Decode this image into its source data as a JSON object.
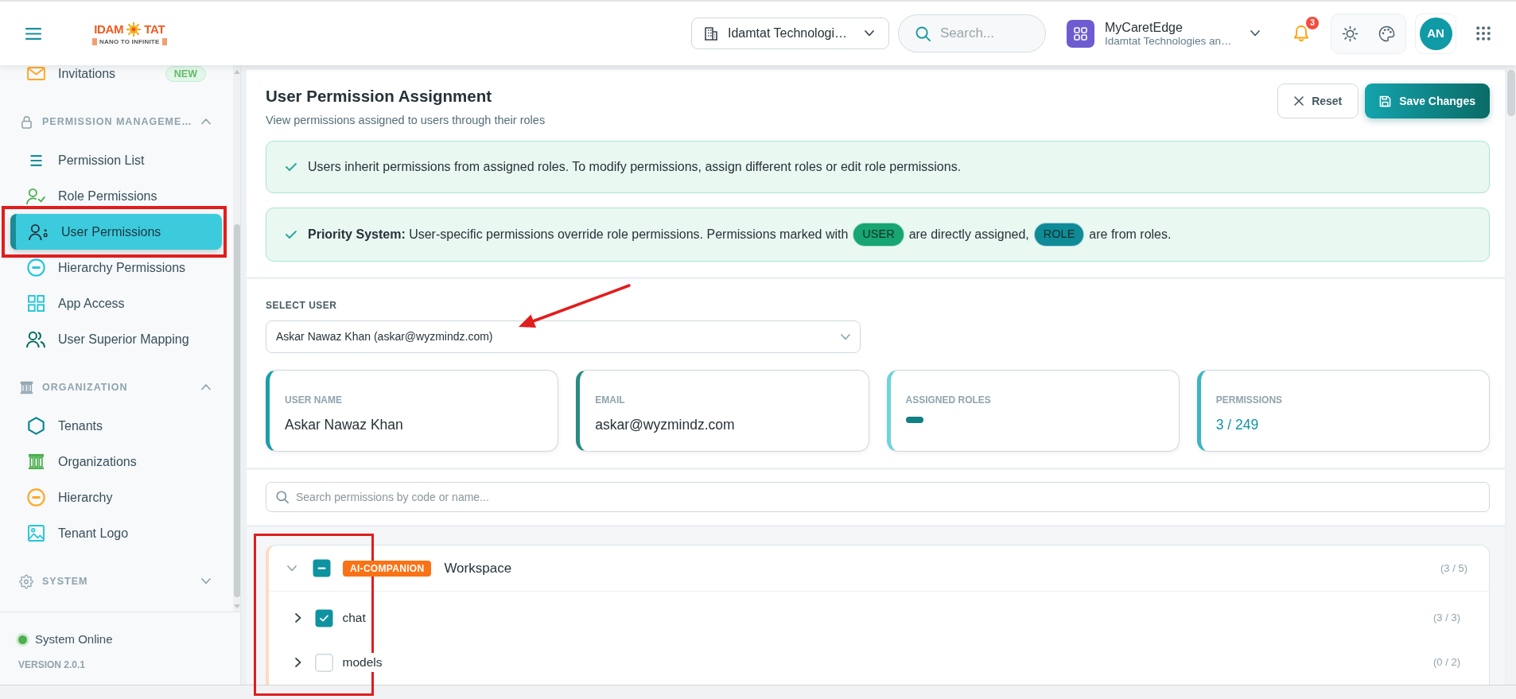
{
  "header": {
    "logo": {
      "left": "IDAM",
      "right": "TAT",
      "tagline": "NANO TO INFINITE"
    },
    "company": {
      "value": "Idamtat Technologi…"
    },
    "search": {
      "placeholder": "Search..."
    },
    "app": {
      "name": "MyCaretEdge",
      "subtitle": "Idamtat Technologies an…"
    },
    "notifications": {
      "count": "3"
    },
    "user": {
      "initials": "AN"
    }
  },
  "sidebar": {
    "groups": [
      {
        "items": [
          {
            "label": "Invitations",
            "badge": "NEW",
            "selected": false,
            "highlighted": false
          }
        ]
      },
      {
        "title": "PERMISSION MANAGEME…",
        "expanded": true,
        "items": [
          {
            "label": "Permission List",
            "selected": false,
            "highlighted": false
          },
          {
            "label": "Role Permissions",
            "selected": false,
            "highlighted": false
          },
          {
            "label": "User Permissions",
            "selected": true,
            "highlighted": true
          },
          {
            "label": "Hierarchy Permissions",
            "selected": false,
            "highlighted": false
          },
          {
            "label": "App Access",
            "selected": false,
            "highlighted": false
          },
          {
            "label": "User Superior Mapping",
            "selected": false,
            "highlighted": false
          }
        ]
      },
      {
        "title": "ORGANIZATION",
        "expanded": true,
        "items": [
          {
            "label": "Tenants",
            "selected": false,
            "highlighted": false
          },
          {
            "label": "Organizations",
            "selected": false,
            "highlighted": false
          },
          {
            "label": "Hierarchy",
            "selected": false,
            "highlighted": false
          },
          {
            "label": "Tenant Logo",
            "selected": false,
            "highlighted": false
          }
        ]
      },
      {
        "title": "SYSTEM",
        "expanded": false
      }
    ],
    "status": {
      "label": "System Online",
      "online": true
    },
    "version": "VERSION 2.0.1"
  },
  "page": {
    "title": "User Permission Assignment",
    "subtitle": "View permissions assigned to users through their roles",
    "buttons": [
      {
        "kind": "secondary",
        "label": "Reset"
      },
      {
        "kind": "primary",
        "label": "Save Changes"
      }
    ]
  },
  "alerts": [
    {
      "parts": [
        {
          "kind": "text",
          "text": "Users inherit permissions from assigned roles. To modify permissions, assign different roles or edit role permissions."
        }
      ]
    },
    {
      "parts": [
        {
          "kind": "text",
          "text": "**Priority System:** User-specific permissions override role permissions. Permissions marked with"
        },
        {
          "kind": "tag",
          "text": "USER",
          "color": "#17a571"
        },
        {
          "kind": "text",
          "text": "are directly assigned,"
        },
        {
          "kind": "tag",
          "text": "ROLE",
          "color": "#0f8b98"
        },
        {
          "kind": "text",
          "text": "are from roles."
        }
      ]
    }
  ],
  "user_select": {
    "label": "SELECT USER",
    "value": "Askar Nawaz Khan (askar@wyzmindz.com)",
    "pointer_arrow": true
  },
  "stats": [
    {
      "kind": "text",
      "label": "USER NAME",
      "value": "Askar Nawaz Khan",
      "color": "#1a9ea8"
    },
    {
      "kind": "text",
      "label": "EMAIL",
      "value": "askar@wyzmindz.com",
      "color": "#2b8a82"
    },
    {
      "kind": "tags",
      "label": "ASSIGNED ROLES",
      "color": "#6fd3de"
    },
    {
      "kind": "count",
      "label": "PERMISSIONS",
      "value": "3 / 249",
      "color": "#3cb5c1"
    }
  ],
  "permission_search": {
    "placeholder": "Search permissions by code or name..."
  },
  "tree": {
    "highlighted": true,
    "groups": [
      {
        "tag": "AI-COMPANION",
        "label": "Workspace",
        "count": "(3 / 5)",
        "expanded": true,
        "checked": false,
        "indeterminate": true,
        "children": [
          {
            "label": "chat",
            "count": "(3 / 3)",
            "expanded": false,
            "checked": true
          },
          {
            "label": "models",
            "count": "(0 / 2)",
            "expanded": false,
            "checked": false
          }
        ]
      }
    ]
  }
}
